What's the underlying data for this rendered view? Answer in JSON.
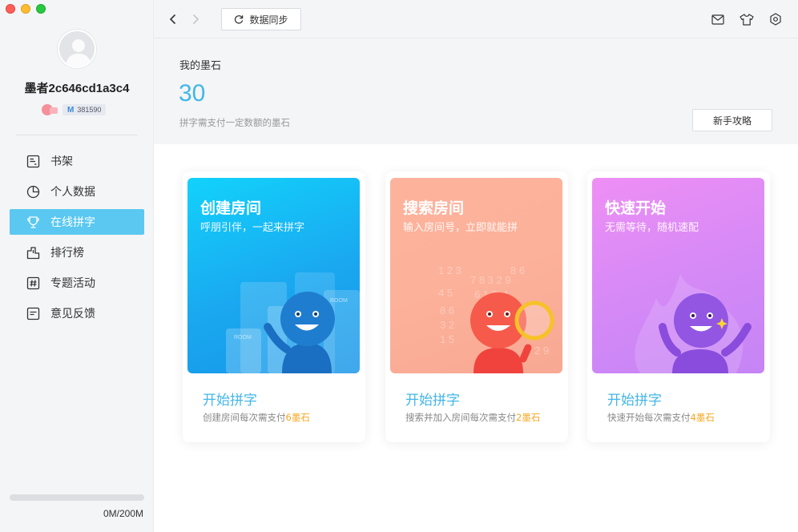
{
  "window": {
    "controls": [
      "close",
      "minimize",
      "zoom"
    ]
  },
  "sidebar": {
    "username": "墨者2c646cd1a3c4",
    "ink_id": "381590",
    "nav": [
      {
        "label": "书架",
        "icon": "bookshelf-icon",
        "active": false
      },
      {
        "label": "个人数据",
        "icon": "pie-chart-icon",
        "active": false
      },
      {
        "label": "在线拼字",
        "icon": "trophy-icon",
        "active": true
      },
      {
        "label": "排行榜",
        "icon": "ranking-icon",
        "active": false
      },
      {
        "label": "专题活动",
        "icon": "hashtag-icon",
        "active": false
      },
      {
        "label": "意见反馈",
        "icon": "feedback-icon",
        "active": false
      }
    ],
    "storage": {
      "text": "0M/200M",
      "fraction": 0
    }
  },
  "topbar": {
    "sync_label": "数据同步",
    "icons": [
      "mail-icon",
      "shirt-icon",
      "settings-icon"
    ]
  },
  "header": {
    "title": "我的墨石",
    "value": "30",
    "description": "拼字需支付一定数额的墨石",
    "guide_label": "新手攻略"
  },
  "cards": [
    {
      "title": "创建房间",
      "subtitle": "呼朋引伴，一起来拼字",
      "cta": "开始拼字",
      "cost_prefix": "创建房间每次需支付",
      "cost_value": "6墨石",
      "color": "#1aa8f0"
    },
    {
      "title": "搜索房间",
      "subtitle": "输入房间号，立即就能拼",
      "cta": "开始拼字",
      "cost_prefix": "搜索并加入房间每次需支付",
      "cost_value": "2墨石",
      "color": "#fcb19a"
    },
    {
      "title": "快速开始",
      "subtitle": "无需等待，随机速配",
      "cta": "开始拼字",
      "cost_prefix": "快速开始每次需支付",
      "cost_value": "4墨石",
      "color": "#d489f6"
    }
  ],
  "colors": {
    "accent": "#43b6e8",
    "active_nav": "#5ac8f0",
    "cost_highlight": "#f6a623"
  }
}
